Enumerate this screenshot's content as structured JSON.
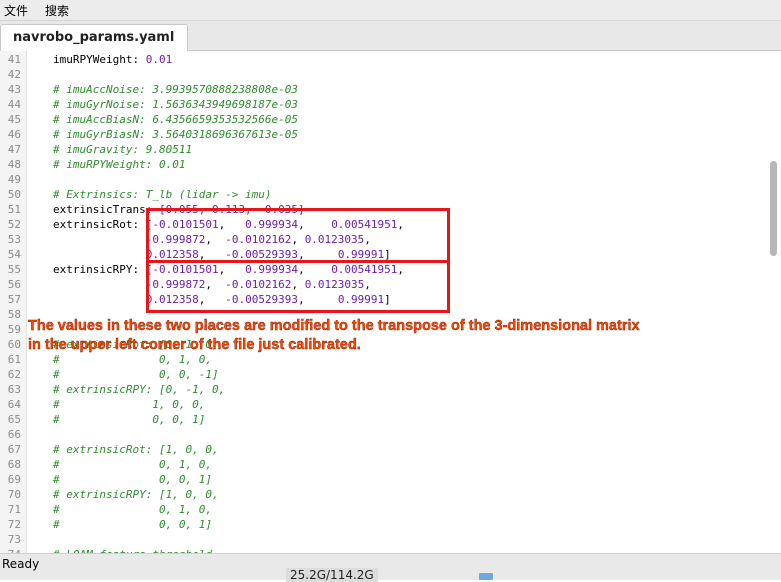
{
  "menu": {
    "file": "文件",
    "search": "搜索"
  },
  "tab": {
    "filename": "navrobo_params.yaml"
  },
  "editor": {
    "lines": [
      {
        "n": "41",
        "segs": [
          [
            "t",
            "imuRPYWeight: "
          ],
          [
            "n",
            "0.01"
          ]
        ]
      },
      {
        "n": "42",
        "segs": []
      },
      {
        "n": "43",
        "segs": [
          [
            "c",
            "# imuAccNoise: 3.9939570888238808e-03"
          ]
        ]
      },
      {
        "n": "44",
        "segs": [
          [
            "c",
            "# imuGyrNoise: 1.5636343949698187e-03"
          ]
        ]
      },
      {
        "n": "45",
        "segs": [
          [
            "c",
            "# imuAccBiasN: 6.4356659353532566e-05"
          ]
        ]
      },
      {
        "n": "46",
        "segs": [
          [
            "c",
            "# imuGyrBiasN: 3.5640318696367613e-05"
          ]
        ]
      },
      {
        "n": "47",
        "segs": [
          [
            "c",
            "# imuGravity: 9.80511"
          ]
        ]
      },
      {
        "n": "48",
        "segs": [
          [
            "c",
            "# imuRPYWeight: 0.01"
          ]
        ]
      },
      {
        "n": "49",
        "segs": []
      },
      {
        "n": "50",
        "segs": [
          [
            "c",
            "# Extrinsics: T_lb (lidar -> imu)"
          ]
        ]
      },
      {
        "n": "51",
        "segs": [
          [
            "t",
            "extrinsicTrans: "
          ],
          [
            "n",
            "[0.055, 0.113, -0.035]"
          ]
        ]
      },
      {
        "n": "52",
        "segs": [
          [
            "t",
            "extrinsicRot: ["
          ],
          [
            "n",
            "-0.0101501"
          ],
          [
            "t",
            ",   "
          ],
          [
            "n",
            "0.999934"
          ],
          [
            "t",
            ",    "
          ],
          [
            "n",
            "0.00541951"
          ],
          [
            "t",
            ","
          ]
        ]
      },
      {
        "n": "53",
        "segs": [
          [
            "t",
            "              "
          ],
          [
            "n",
            "-0.999872"
          ],
          [
            "t",
            ",  "
          ],
          [
            "n",
            "-0.0102162"
          ],
          [
            "t",
            ", "
          ],
          [
            "n",
            "0.0123035"
          ],
          [
            "t",
            ","
          ]
        ]
      },
      {
        "n": "54",
        "segs": [
          [
            "t",
            "              "
          ],
          [
            "n",
            "0.012358"
          ],
          [
            "t",
            ",   "
          ],
          [
            "n",
            "-0.00529393"
          ],
          [
            "t",
            ",     "
          ],
          [
            "n",
            "0.99991"
          ],
          [
            "t",
            "]"
          ]
        ]
      },
      {
        "n": "55",
        "segs": [
          [
            "t",
            "extrinsicRPY: "
          ],
          [
            "k",
            "["
          ],
          [
            "n",
            "-0.0101501"
          ],
          [
            "t",
            ",   "
          ],
          [
            "n",
            "0.999934"
          ],
          [
            "t",
            ",    "
          ],
          [
            "n",
            "0.00541951"
          ],
          [
            "t",
            ","
          ]
        ]
      },
      {
        "n": "56",
        "segs": [
          [
            "t",
            "              "
          ],
          [
            "n",
            "-0.999872"
          ],
          [
            "t",
            ",  "
          ],
          [
            "n",
            "-0.0102162"
          ],
          [
            "t",
            ", "
          ],
          [
            "n",
            "0.0123035"
          ],
          [
            "t",
            ","
          ]
        ]
      },
      {
        "n": "57",
        "segs": [
          [
            "t",
            "              "
          ],
          [
            "n",
            "0.012358"
          ],
          [
            "t",
            ",   "
          ],
          [
            "n",
            "-0.00529393"
          ],
          [
            "t",
            ",     "
          ],
          [
            "n",
            "0.99991"
          ],
          [
            "t",
            "]"
          ]
        ]
      },
      {
        "n": "58",
        "segs": []
      },
      {
        "n": "59",
        "segs": []
      },
      {
        "n": "60",
        "segs": [
          [
            "c",
            "# extrinsicRot: [0, 1, 0,"
          ]
        ]
      },
      {
        "n": "61",
        "segs": [
          [
            "c",
            "#               0, 1, 0,"
          ]
        ]
      },
      {
        "n": "62",
        "segs": [
          [
            "c",
            "#               0, 0, -1]"
          ]
        ]
      },
      {
        "n": "63",
        "segs": [
          [
            "c",
            "# extrinsicRPY: [0, -1, 0,"
          ]
        ]
      },
      {
        "n": "64",
        "segs": [
          [
            "c",
            "#              1, 0, 0,"
          ]
        ]
      },
      {
        "n": "65",
        "segs": [
          [
            "c",
            "#              0, 0, 1]"
          ]
        ]
      },
      {
        "n": "66",
        "segs": []
      },
      {
        "n": "67",
        "segs": [
          [
            "c",
            "# extrinsicRot: [1, 0, 0,"
          ]
        ]
      },
      {
        "n": "68",
        "segs": [
          [
            "c",
            "#               0, 1, 0,"
          ]
        ]
      },
      {
        "n": "69",
        "segs": [
          [
            "c",
            "#               0, 0, 1]"
          ]
        ]
      },
      {
        "n": "70",
        "segs": [
          [
            "c",
            "# extrinsicRPY: [1, 0, 0,"
          ]
        ]
      },
      {
        "n": "71",
        "segs": [
          [
            "c",
            "#               0, 1, 0,"
          ]
        ]
      },
      {
        "n": "72",
        "segs": [
          [
            "c",
            "#               0, 0, 1]"
          ]
        ]
      },
      {
        "n": "73",
        "segs": []
      },
      {
        "n": "74",
        "segs": [
          [
            "c",
            "# LOAM feature threshold"
          ]
        ]
      }
    ]
  },
  "annotation": {
    "line1": "The values in these two places are modified to the transpose of the 3-dimensional matrix",
    "line2": "in the upper left corner of the file just calibrated.",
    "color": "#ff4500",
    "box_color": "#e8161a"
  },
  "statusbar": {
    "status": "Ready",
    "disk": "25.2G/114.2G"
  }
}
